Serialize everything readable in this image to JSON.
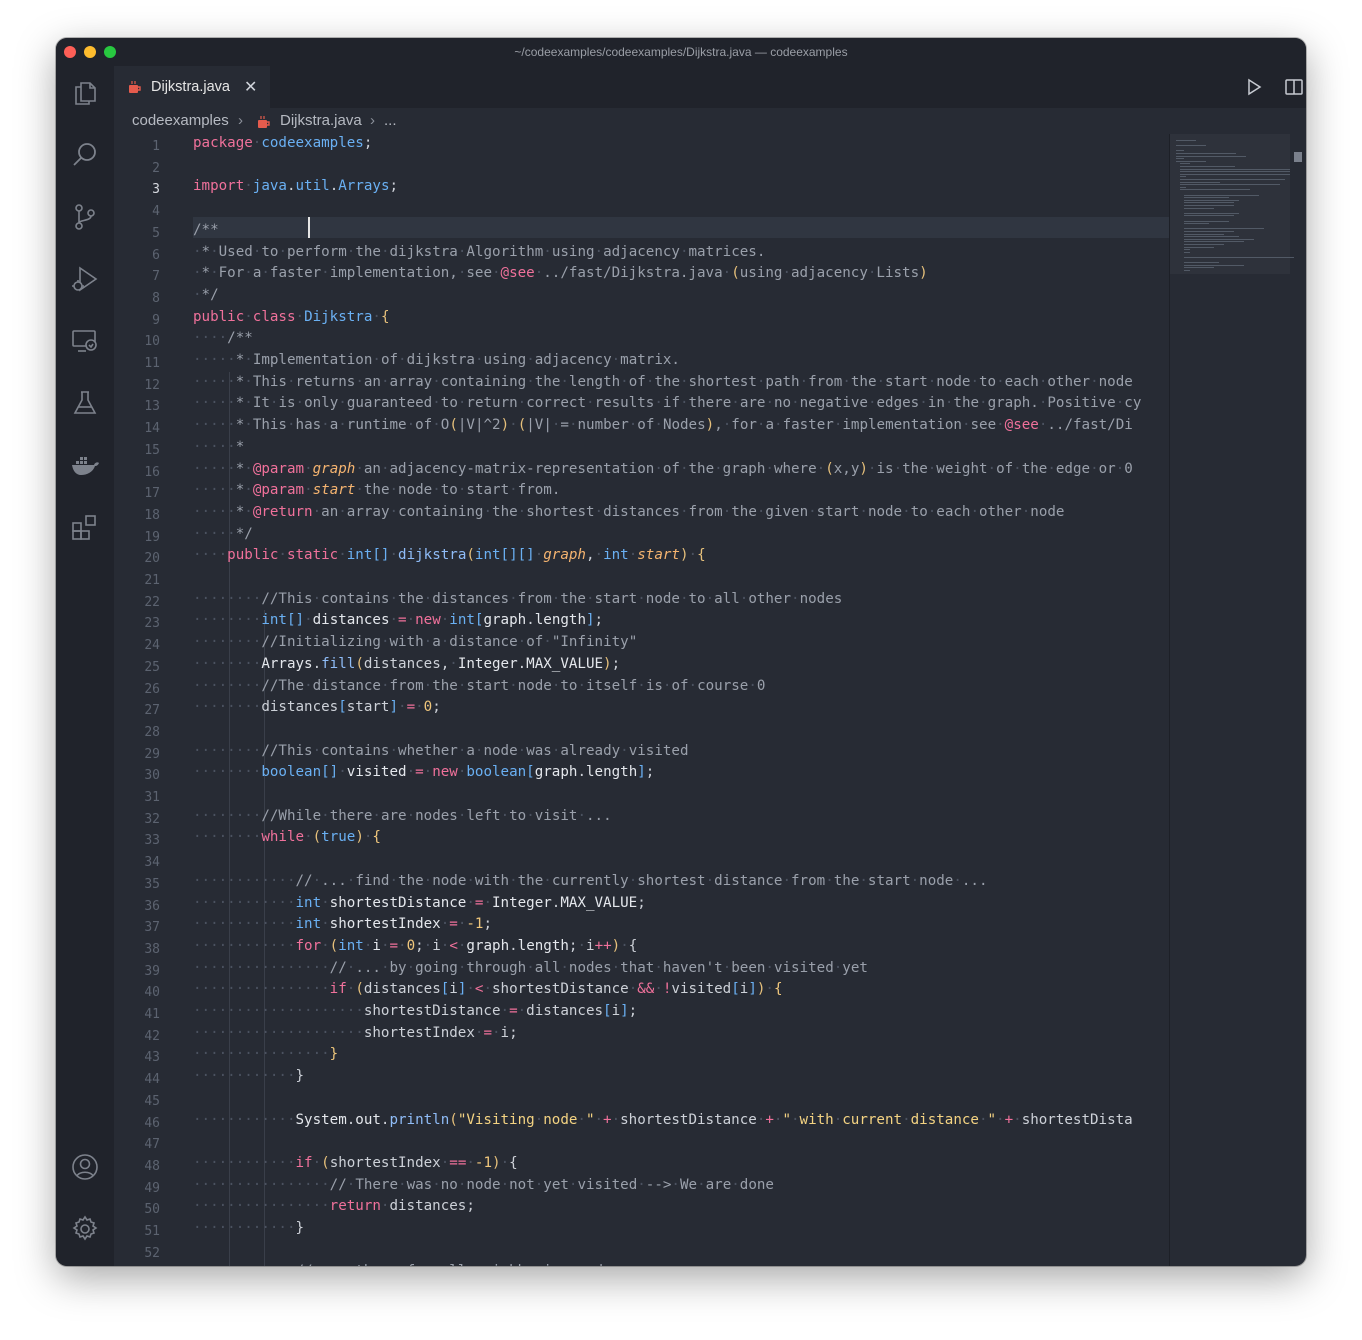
{
  "window": {
    "title": "~/codeexamples/codeexamples/Dijkstra.java — codeexamples"
  },
  "activity_bar": [
    "files-icon",
    "search-icon",
    "source-control-icon",
    "run-debug-icon",
    "remote-explorer-icon",
    "testing-icon",
    "docker-icon",
    "extensions-icon",
    "account-icon",
    "settings-gear-icon"
  ],
  "tab": {
    "label": "Dijkstra.java",
    "close": "✕"
  },
  "breadcrumb": {
    "folder": "codeexamples",
    "sep": "›",
    "file": "Dijkstra.java",
    "ellipsis": "..."
  },
  "editor": {
    "active_line": "3",
    "line_numbers": [
      "1",
      "2",
      "3",
      "4",
      "5",
      "6",
      "7",
      "8",
      "9",
      "10",
      "11",
      "12",
      "13",
      "14",
      "15",
      "16",
      "17",
      "18",
      "19",
      "20",
      "21",
      "22",
      "23",
      "24",
      "25",
      "26",
      "27",
      "28",
      "29",
      "30",
      "31",
      "32",
      "33",
      "34",
      "35",
      "36",
      "37",
      "38",
      "39",
      "40",
      "41",
      "42",
      "43",
      "44",
      "45",
      "46",
      "47",
      "48",
      "49",
      "50",
      "51",
      "52"
    ]
  },
  "colors": {
    "background": "#272b34",
    "keyword": "#f0719b",
    "type": "#6ab0f3",
    "string": "#f4d382",
    "comment": "#9aa0ab"
  }
}
